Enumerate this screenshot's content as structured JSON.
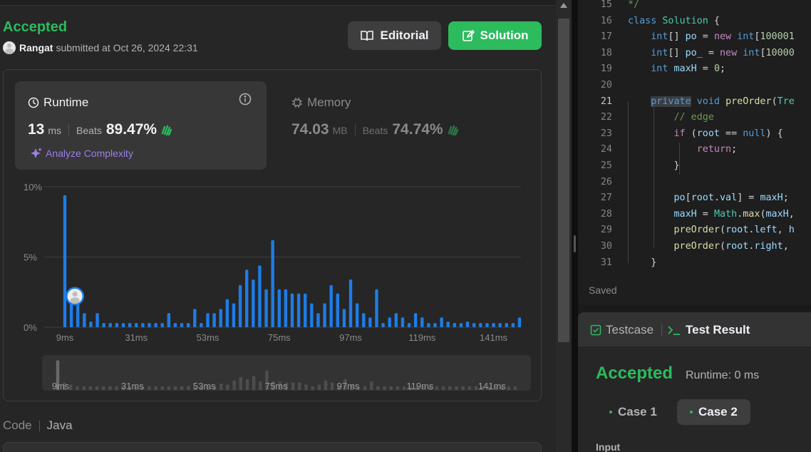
{
  "submission": {
    "status": "Accepted",
    "username": "Rangat",
    "submitted_text": "submitted at Oct 26, 2024 22:31"
  },
  "buttons": {
    "editorial": "Editorial",
    "solution": "Solution"
  },
  "runtime": {
    "title": "Runtime",
    "value": "13",
    "unit": "ms",
    "beats_label": "Beats",
    "beats_value": "89.47%",
    "analyze_label": "Analyze Complexity"
  },
  "memory": {
    "title": "Memory",
    "value": "74.03",
    "unit": "MB",
    "beats_label": "Beats",
    "beats_value": "74.74%"
  },
  "chart_data": {
    "type": "bar",
    "y_tick_labels": [
      "10%",
      "5%",
      "0%"
    ],
    "ylim": [
      0,
      10
    ],
    "x_tick_labels": [
      "9ms",
      "31ms",
      "53ms",
      "75ms",
      "97ms",
      "119ms",
      "141ms"
    ],
    "user_bar_index": 2,
    "values": [
      9.4,
      2.3,
      1.7,
      1.0,
      0.4,
      1.0,
      0.3,
      0.3,
      0.3,
      0.3,
      0.3,
      0.3,
      0.3,
      0.3,
      0.3,
      0.3,
      1.0,
      0.3,
      0.3,
      0.3,
      1.3,
      0.3,
      1.0,
      1.0,
      1.3,
      2.0,
      1.7,
      3.0,
      4.1,
      3.4,
      4.4,
      2.7,
      6.2,
      2.7,
      2.7,
      2.4,
      2.4,
      2.4,
      1.7,
      1.0,
      1.7,
      3.0,
      2.4,
      1.3,
      3.4,
      1.7,
      1.0,
      0.7,
      2.7,
      0.3,
      0.7,
      1.0,
      0.7,
      0.3,
      1.0,
      0.7,
      0.3,
      0.3,
      0.7,
      0.4,
      0.3,
      0.3,
      0.4,
      0.3,
      0.3,
      0.3,
      0.3,
      0.3,
      0.3,
      0.3,
      0.7
    ]
  },
  "code_section": {
    "label": "Code",
    "language": "Java"
  },
  "editor": {
    "saved_label": "Saved",
    "lines": [
      {
        "num": "15",
        "text": "*/"
      },
      {
        "num": "16",
        "text": "class Solution {"
      },
      {
        "num": "17",
        "text": "    int[] po = new int[100001"
      },
      {
        "num": "18",
        "text": "    int[] po_ = new int[10000"
      },
      {
        "num": "19",
        "text": "    int maxH = 0;"
      },
      {
        "num": "20",
        "text": ""
      },
      {
        "num": "21",
        "text": "    private void preOrder(Tre"
      },
      {
        "num": "22",
        "text": "        // edge"
      },
      {
        "num": "23",
        "text": "        if (root == null) {"
      },
      {
        "num": "24",
        "text": "            return;"
      },
      {
        "num": "25",
        "text": "        }"
      },
      {
        "num": "26",
        "text": ""
      },
      {
        "num": "27",
        "text": "        po[root.val] = maxH;"
      },
      {
        "num": "28",
        "text": "        maxH = Math.max(maxH,"
      },
      {
        "num": "29",
        "text": "        preOrder(root.left, h"
      },
      {
        "num": "30",
        "text": "        preOrder(root.right, "
      },
      {
        "num": "31",
        "text": "    }"
      }
    ]
  },
  "results": {
    "testcase_tab": "Testcase",
    "result_tab": "Test Result",
    "status": "Accepted",
    "runtime_text": "Runtime: 0 ms",
    "case1": "Case 1",
    "case2": "Case 2",
    "input_label": "Input"
  }
}
